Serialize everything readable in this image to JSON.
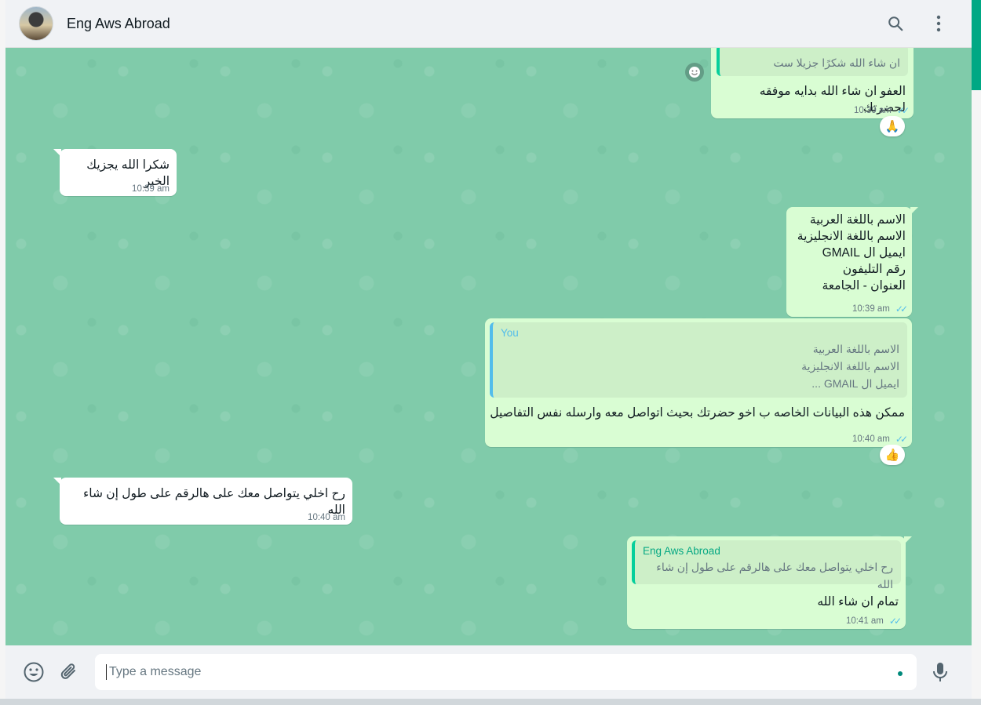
{
  "header": {
    "contact_name": "Eng Aws Abroad",
    "icons": [
      "avatar",
      "search-icon",
      "menu-icon"
    ]
  },
  "messages": [
    {
      "direction": "outgoing",
      "quote_text": "ان شاء الله شكرًا جزيلا ست",
      "text": "العفو ان شاء الله بدايه موفقه لحضرتك",
      "time": "10:39 am",
      "reaction": "🙏"
    },
    {
      "direction": "incoming",
      "text": "شكرا الله يجزيك الخير",
      "time": "10:39 am"
    },
    {
      "direction": "outgoing",
      "lines": [
        "الاسم باللغة العربية",
        "الاسم باللغة الانجليزية",
        "ايميل ال GMAIL",
        "رقم التليفون",
        "العنوان - الجامعة"
      ],
      "time": "10:39 am"
    },
    {
      "direction": "outgoing",
      "quote_author": "You",
      "quote_lines": [
        "الاسم باللغة العربية",
        "الاسم باللغة الانجليزية",
        "ايميل ال GMAIL ..."
      ],
      "text": "ممكن هذه البيانات الخاصه ب اخو حضرتك بحيث اتواصل معه وارسله نفس التفاصيل",
      "time": "10:40 am",
      "reaction": "👍"
    },
    {
      "direction": "incoming",
      "text": "رح اخلي يتواصل معك على هالرقم على طول إن شاء الله",
      "time": "10:40 am"
    },
    {
      "direction": "outgoing",
      "quote_author": "Eng Aws Abroad",
      "quote_text": "رح اخلي يتواصل معك على هالرقم على طول إن شاء الله",
      "text": "تمام ان شاء الله",
      "time": "10:41 am"
    }
  ],
  "composer": {
    "placeholder": "Type a message"
  },
  "colors": {
    "chat_bg": "#80cbaa",
    "outgoing_bubble": "#d9fdd3",
    "incoming_bubble": "#ffffff",
    "accent": "#00a884",
    "read_ticks": "#53bdeb",
    "quote_you": "#53bdeb",
    "quote_contact": "#06cf9c"
  }
}
